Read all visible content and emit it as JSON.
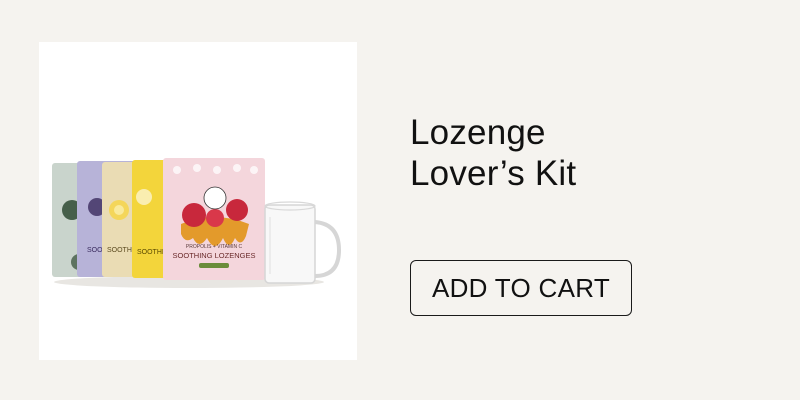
{
  "product": {
    "title_line1": "Lozenge",
    "title_line2": "Lover’s Kit",
    "add_to_cart_label": "ADD TO CART",
    "image": {
      "front_pouch_line1": "PROPOLIS + VITAMIN C",
      "front_pouch_line2": "SOOTHING LOZENGES",
      "back_pouch_label": "SOO",
      "yellow_pouch_label": "SOOTHING",
      "colors": {
        "pouch_sage": "#c9d4cc",
        "pouch_lavender": "#b7b3d8",
        "pouch_cream": "#eadcb4",
        "pouch_yellow": "#f3d53b",
        "pouch_pink": "#f4d6dc",
        "honey": "#e39a2b",
        "raspberry": "#c8283c"
      }
    }
  }
}
